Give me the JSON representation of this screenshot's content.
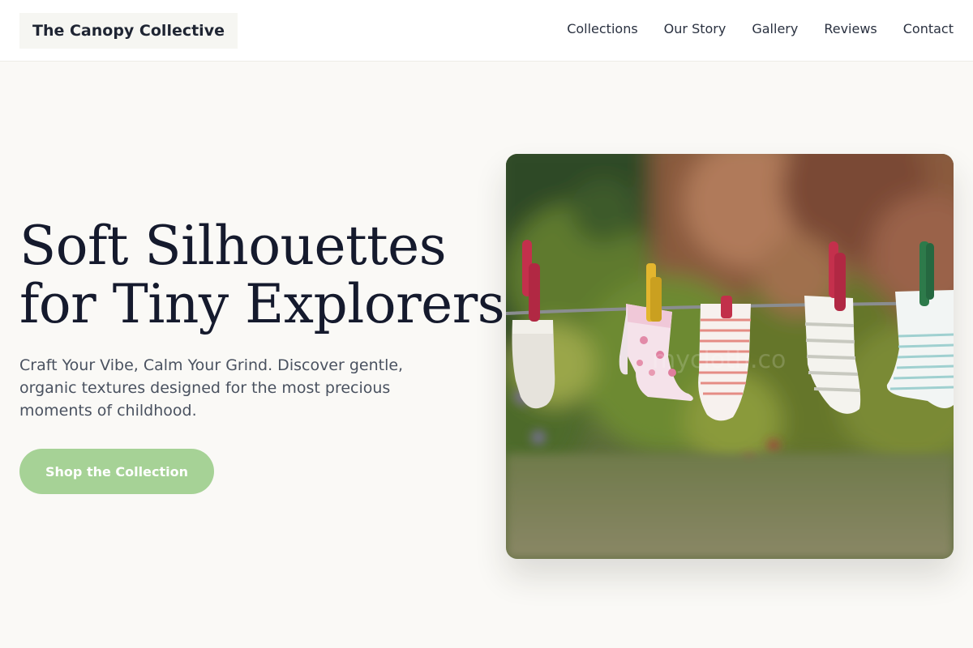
{
  "header": {
    "brand": "The Canopy Collective",
    "nav": [
      "Collections",
      "Our Story",
      "Gallery",
      "Reviews",
      "Contact"
    ]
  },
  "hero": {
    "title_line1": "Soft Silhouettes",
    "title_line2": "for Tiny Explorers.",
    "subtitle": "Craft Your Vibe, Calm Your Grind. Discover gentle, organic textures designed for the most precious moments of childhood.",
    "cta_label": "Shop the Collection",
    "image_watermark": "mycloth.co"
  },
  "colors": {
    "background": "#faf9f6",
    "cta": "#a6d296",
    "title": "#151a2d"
  },
  "icons": [
    "hero-photo-baby-socks-on-clothesline"
  ]
}
